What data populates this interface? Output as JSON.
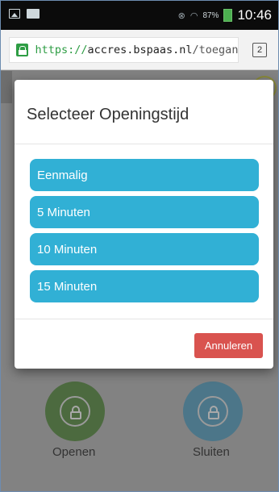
{
  "status_bar": {
    "signal_text": "87%",
    "time": "10:46"
  },
  "browser": {
    "url_scheme": "https://",
    "url_host": "accres.bspaas.nl",
    "url_path": "/toegang",
    "tab_count": "2"
  },
  "background": {
    "open_label": "Openen",
    "close_label": "Sluiten"
  },
  "modal": {
    "title": "Selecteer Openingstijd",
    "options": [
      {
        "label": "Eenmalig"
      },
      {
        "label": "5 Minuten"
      },
      {
        "label": "10 Minuten"
      },
      {
        "label": "15 Minuten"
      },
      {
        "label": ""
      }
    ],
    "cancel_label": "Annuleren"
  },
  "colors": {
    "option": "#31b0d5",
    "cancel": "#d9534f",
    "secure": "#2e9d44"
  }
}
